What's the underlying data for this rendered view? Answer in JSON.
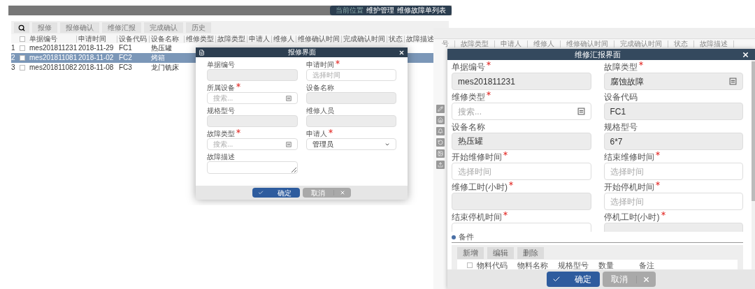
{
  "list_screen": {
    "breadcrumb": [
      "当前位置",
      "维护管理",
      "维修故障单列表"
    ],
    "toolbar": [
      "报修",
      "报修确认",
      "维修汇报",
      "完成确认",
      "历史"
    ],
    "columns": [
      "单据编号",
      "申请时间",
      "设备代码",
      "设备名称",
      "维修类型",
      "故障类型",
      "申请人",
      "维修人",
      "维修确认时间",
      "完成确认时间",
      "状态",
      "故障描述"
    ],
    "all_checked": false,
    "rows": [
      {
        "no": "1",
        "selected": false,
        "checked": false,
        "cells": [
          "mes201811231",
          "2018-11-29",
          "FC1",
          "热压罐"
        ]
      },
      {
        "no": "2",
        "selected": true,
        "checked": false,
        "cells": [
          "mes201811081",
          "2018-11-02",
          "FC2",
          "烤箱"
        ]
      },
      {
        "no": "3",
        "selected": false,
        "checked": false,
        "cells": [
          "mes201811082",
          "2018-11-08",
          "FC3",
          "龙门铣床"
        ]
      }
    ],
    "dialog": {
      "title": "报修界面",
      "fields": [
        {
          "label": "单据编号",
          "required": false,
          "kind": "text",
          "disabled": true
        },
        {
          "label": "申请时间",
          "required": true,
          "kind": "text",
          "disabled": false,
          "placeholder": "选择时间"
        },
        {
          "label": "所属设备",
          "required": true,
          "kind": "picker",
          "disabled": false,
          "placeholder": "搜索..."
        },
        {
          "label": "设备名称",
          "required": false,
          "kind": "text",
          "disabled": true
        },
        {
          "label": "规格型号",
          "required": false,
          "kind": "text",
          "disabled": true
        },
        {
          "label": "维修人员",
          "required": false,
          "kind": "text",
          "disabled": true
        },
        {
          "label": "故障类型",
          "required": true,
          "kind": "picker",
          "disabled": false,
          "placeholder": "搜索..."
        },
        {
          "label": "申请人",
          "required": true,
          "kind": "select",
          "disabled": false,
          "value": "管理员"
        },
        {
          "label": "故障描述",
          "required": false,
          "kind": "textarea",
          "disabled": false
        }
      ],
      "ok": "确定",
      "cancel": "取消"
    }
  },
  "report_screen": {
    "columns": [
      "号",
      "故障类型",
      "申请人",
      "维修人",
      "维修确认时间",
      "完成确认时间",
      "状态",
      "故障描述"
    ],
    "dialog": {
      "title": "维修汇报界面",
      "fields": [
        {
          "label": "单据编号",
          "required": true,
          "kind": "text",
          "disabled": true,
          "value": "mes201811231"
        },
        {
          "label": "故障类型",
          "required": true,
          "kind": "picker",
          "disabled": true,
          "value": "腐蚀故障"
        },
        {
          "label": "维修类型",
          "required": true,
          "kind": "picker",
          "disabled": false,
          "placeholder": "搜索..."
        },
        {
          "label": "设备代码",
          "required": false,
          "kind": "text",
          "disabled": true,
          "value": "FC1"
        },
        {
          "label": "设备名称",
          "required": false,
          "kind": "text",
          "disabled": true,
          "value": "热压罐"
        },
        {
          "label": "规格型号",
          "required": false,
          "kind": "text",
          "disabled": true,
          "value": "6*7"
        },
        {
          "label": "开始维修时间",
          "required": true,
          "kind": "text",
          "disabled": false,
          "placeholder": "选择时间"
        },
        {
          "label": "结束维修时间",
          "required": true,
          "kind": "text",
          "disabled": false,
          "placeholder": "选择时间"
        },
        {
          "label": "维修工时(小时)",
          "required": true,
          "kind": "text",
          "disabled": true
        },
        {
          "label": "开始停机时间",
          "required": true,
          "kind": "text",
          "disabled": false,
          "placeholder": "选择时间"
        },
        {
          "label": "结束停机时间",
          "required": true,
          "kind": "text",
          "disabled": false
        },
        {
          "label": "停机工时(小时)",
          "required": true,
          "kind": "text",
          "disabled": true
        }
      ],
      "parts": {
        "title": "备件",
        "all_checked": false,
        "buttons": [
          "新增",
          "编辑",
          "删除"
        ],
        "columns": [
          "物料代码",
          "物料名称",
          "规格型号",
          "数量",
          "备注"
        ]
      },
      "ok": "确定",
      "cancel": "取消"
    }
  }
}
